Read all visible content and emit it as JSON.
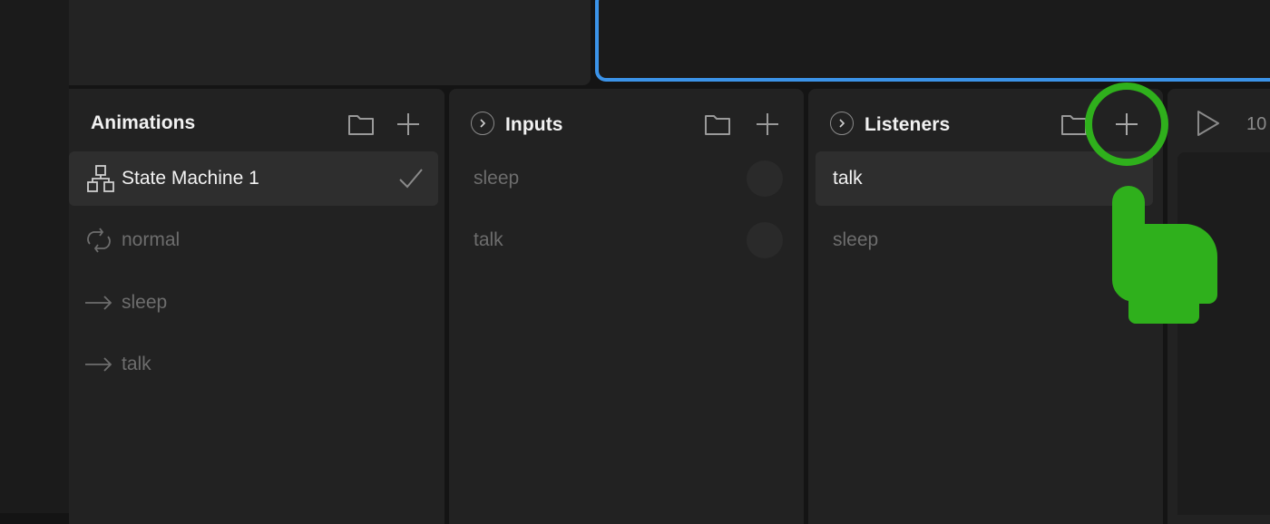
{
  "colors": {
    "background": "#141414",
    "panel": "#222222",
    "selected_row": "#2e2e2e",
    "accent_blue": "#3b93e8",
    "highlight_green": "#2fb01c",
    "text_primary": "#f2f2f2",
    "text_muted": "#6d6d6d"
  },
  "animations_panel": {
    "title": "Animations",
    "icons": [
      "folder-icon",
      "plus-icon"
    ],
    "items": [
      {
        "label": "State Machine 1",
        "icon": "state-machine-icon",
        "selected": true,
        "checked": true
      },
      {
        "label": "normal",
        "icon": "loop-icon",
        "selected": false
      },
      {
        "label": "sleep",
        "icon": "arrow-right-icon",
        "selected": false
      },
      {
        "label": "talk",
        "icon": "arrow-right-icon",
        "selected": false
      }
    ]
  },
  "inputs_panel": {
    "title": "Inputs",
    "icons": [
      "chevron-right-icon",
      "folder-icon",
      "plus-icon"
    ],
    "items": [
      {
        "label": "sleep",
        "control": "trigger-dot"
      },
      {
        "label": "talk",
        "control": "trigger-dot"
      }
    ]
  },
  "listeners_panel": {
    "title": "Listeners",
    "icons": [
      "chevron-right-icon",
      "folder-icon",
      "plus-icon"
    ],
    "items": [
      {
        "label": "talk",
        "selected": true
      },
      {
        "label": "sleep",
        "selected": false
      }
    ]
  },
  "timeline_panel": {
    "icons": [
      "play-icon"
    ],
    "fps_partial": "10"
  },
  "annotation": {
    "target": "add-listener-button",
    "icons": [
      "highlight-ring",
      "pointing-hand-icon"
    ]
  }
}
